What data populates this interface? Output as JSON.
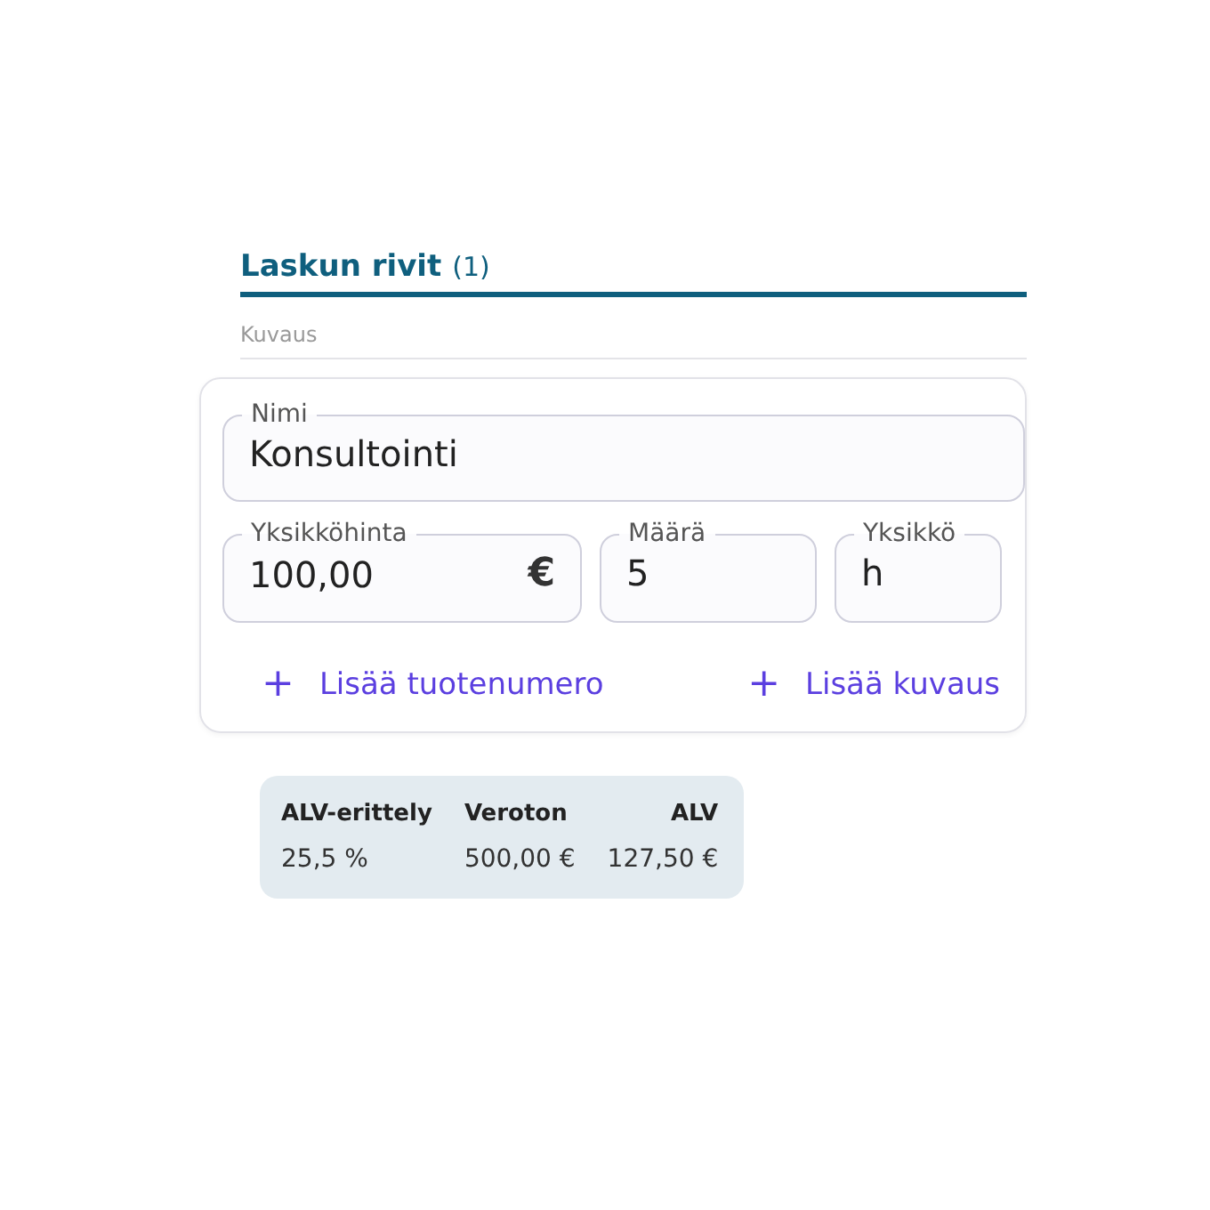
{
  "section": {
    "title": "Laskun rivit",
    "count": "(1)"
  },
  "column_label": "Kuvaus",
  "name_field": {
    "label": "Nimi",
    "value": "Konsultointi"
  },
  "fields": [
    {
      "label": "Yksikköhinta",
      "value": "100,00",
      "suffix": "€"
    },
    {
      "label": "Määrä",
      "value": "5"
    },
    {
      "label": "Yksikkö",
      "value": "h"
    }
  ],
  "actions": [
    {
      "icon": "+",
      "label": "Lisää tuotenumero"
    },
    {
      "icon": "+",
      "label": "Lisää kuvaus"
    }
  ],
  "vat_table": {
    "columns": [
      "ALV-erittely",
      "Veroton",
      "ALV"
    ],
    "rows": [
      [
        "25,5 %",
        "500,00 €",
        "127,50 €"
      ]
    ]
  }
}
